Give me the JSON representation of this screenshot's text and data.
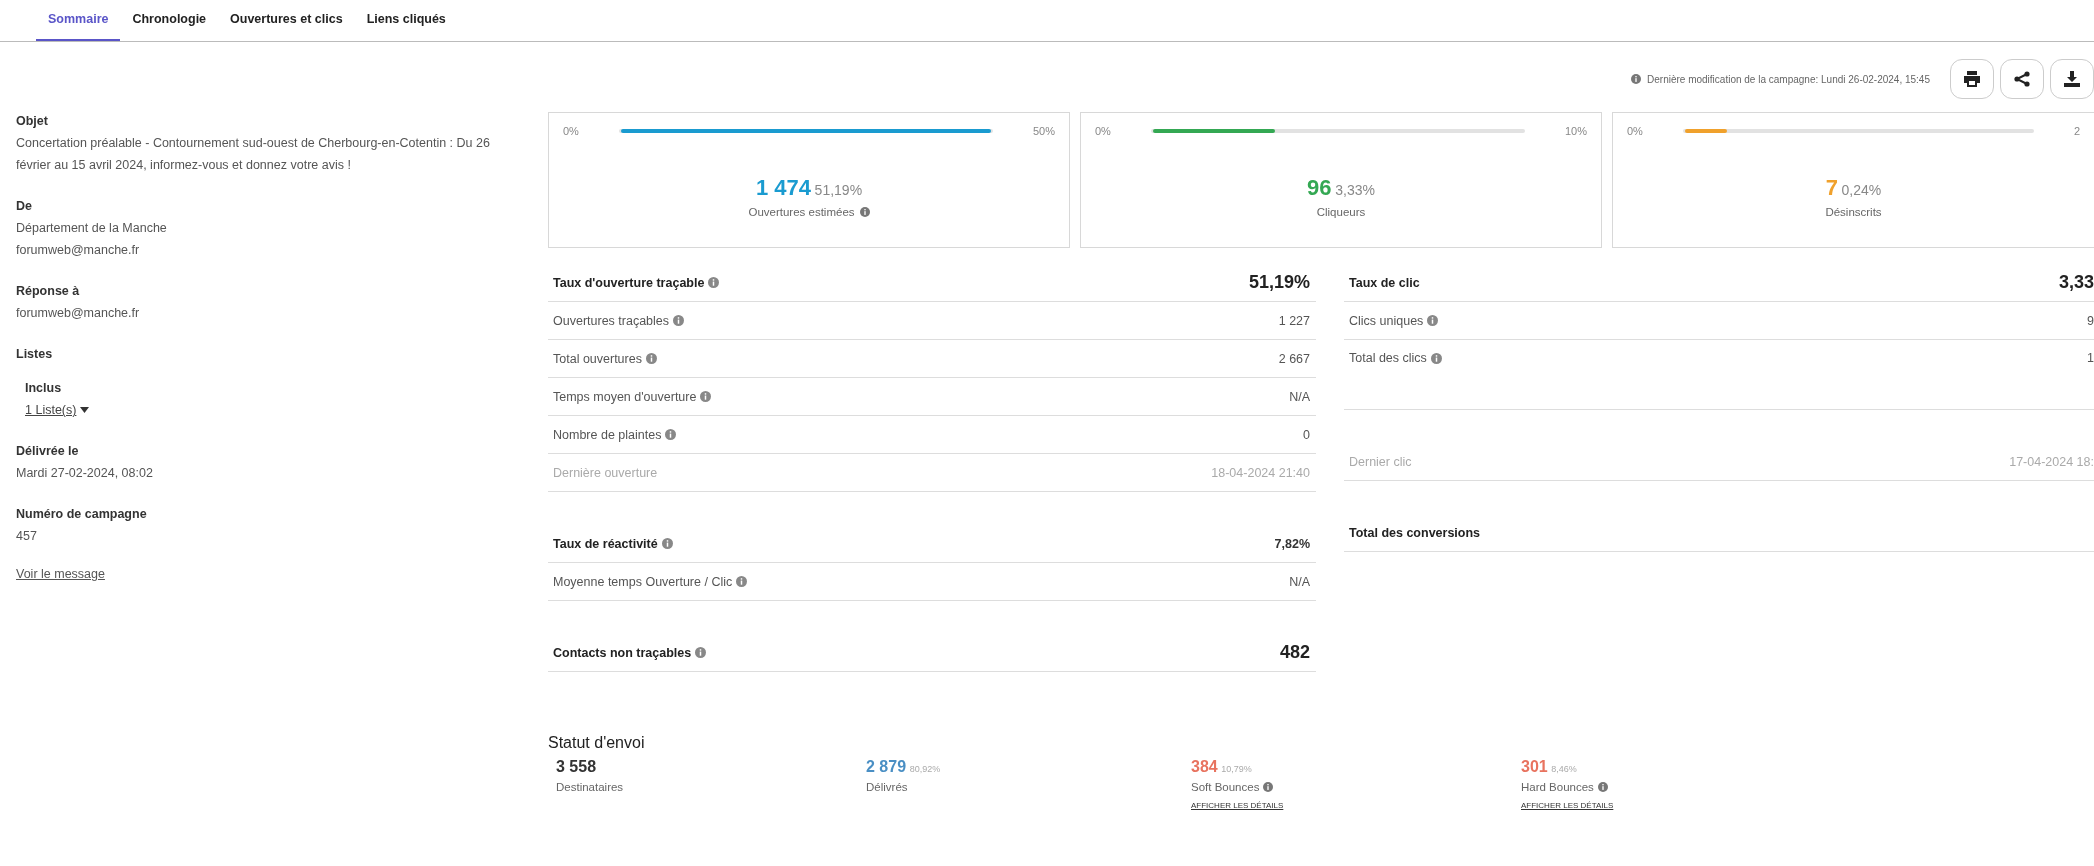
{
  "tabs": [
    {
      "label": "Sommaire",
      "selected": true
    },
    {
      "label": "Chronologie",
      "selected": false
    },
    {
      "label": "Ouvertures et clics",
      "selected": false
    },
    {
      "label": "Liens cliqués",
      "selected": false
    }
  ],
  "last_modified": "Dernière modification de la campagne:  Lundi 26-02-2024, 15:45",
  "summary": {
    "fields": [
      {
        "label": "Objet",
        "lines": [
          "Concertation préalable - Contournement sud-ouest de Cherbourg-en-Cotentin : Du 26 février au 15 avril 2024, informez-vous et donnez votre avis !"
        ]
      },
      {
        "label": "De",
        "lines": [
          "Département de la Manche",
          "forumweb@manche.fr"
        ]
      },
      {
        "label": "Réponse à",
        "lines": [
          "forumweb@manche.fr"
        ]
      }
    ],
    "lists": {
      "label": "Listes",
      "sublabel": "Inclus",
      "link": "1 Liste(s)"
    },
    "fields_after": [
      {
        "label": "Délivrée le",
        "lines": [
          "Mardi 27-02-2024, 08:02"
        ]
      },
      {
        "label": "Numéro de campagne",
        "lines": [
          "457"
        ]
      }
    ],
    "link": "Voir le message"
  },
  "cards": [
    {
      "min": "0%",
      "max": "50%",
      "level": 1.0,
      "color": "#1a9bd0",
      "value": "1 474",
      "percent": "51,19%",
      "label": "Ouvertures estimées",
      "info": true
    },
    {
      "min": "0%",
      "max": "10%",
      "level": 0.33,
      "color": "#34a853",
      "value": "96",
      "percent": "3,33%",
      "label": "Cliqueurs",
      "info": false
    },
    {
      "min": "0%",
      "max": "2",
      "level": 0.12,
      "color": "#f0a12c",
      "value": "7",
      "percent": "0,24%",
      "label": "Désinscrits",
      "info": false
    }
  ],
  "left_table": [
    [
      {
        "kind": "total",
        "label": "Taux d'ouverture traçable",
        "info": true,
        "value": "51,19%"
      },
      {
        "kind": "item",
        "label": "Ouvertures traçables",
        "info": true,
        "value": "1 227"
      },
      {
        "kind": "item",
        "label": "Total ouvertures",
        "info": true,
        "value": "2 667"
      },
      {
        "kind": "item",
        "label": "Temps moyen d'ouverture",
        "info": true,
        "value": "N/A"
      },
      {
        "kind": "item",
        "label": "Nombre de plaintes",
        "info": true,
        "value": "0"
      },
      {
        "kind": "muted",
        "label": "Dernière ouverture",
        "info": false,
        "value": "18-04-2024 21:40"
      }
    ],
    [
      {
        "kind": "subtotal",
        "label": "Taux de réactivité",
        "info": true,
        "value": "7,82%"
      },
      {
        "kind": "item",
        "label": "Moyenne temps Ouverture / Clic",
        "info": true,
        "value": "N/A"
      }
    ],
    [
      {
        "kind": "total",
        "label": "Contacts non traçables",
        "info": true,
        "value": "482"
      }
    ]
  ],
  "right_table": [
    [
      {
        "kind": "total",
        "label": "Taux de clic",
        "info": false,
        "value": "3,33"
      },
      {
        "kind": "item",
        "label": "Clics uniques",
        "info": true,
        "value": "9"
      },
      {
        "kind": "item",
        "label": "Total des clics",
        "info": true,
        "value": "1"
      }
    ],
    [
      {
        "kind": "muted",
        "label": "Dernier clic",
        "info": false,
        "value": "17-04-2024 18:"
      }
    ],
    [
      {
        "kind": "subtotal",
        "label": "Total des conversions",
        "info": false
      }
    ]
  ],
  "status": {
    "title": "Statut d'envoi",
    "items": [
      {
        "value": "3 558",
        "label": "Destinataires",
        "color": "#333333",
        "info": false
      },
      {
        "value": "2 879",
        "percent": "80,92%",
        "label": "Délivrés",
        "color": "#4a8fc4",
        "info": false
      },
      {
        "value": "384",
        "percent": "10,79%",
        "label": "Soft Bounces",
        "color": "#e8735f",
        "info": true,
        "link": "AFFICHER LES DÉTAILS"
      },
      {
        "value": "301",
        "percent": "8,46%",
        "label": "Hard Bounces",
        "color": "#e8735f",
        "info": true,
        "link": "AFFICHER LES DÉTAILS"
      }
    ]
  }
}
